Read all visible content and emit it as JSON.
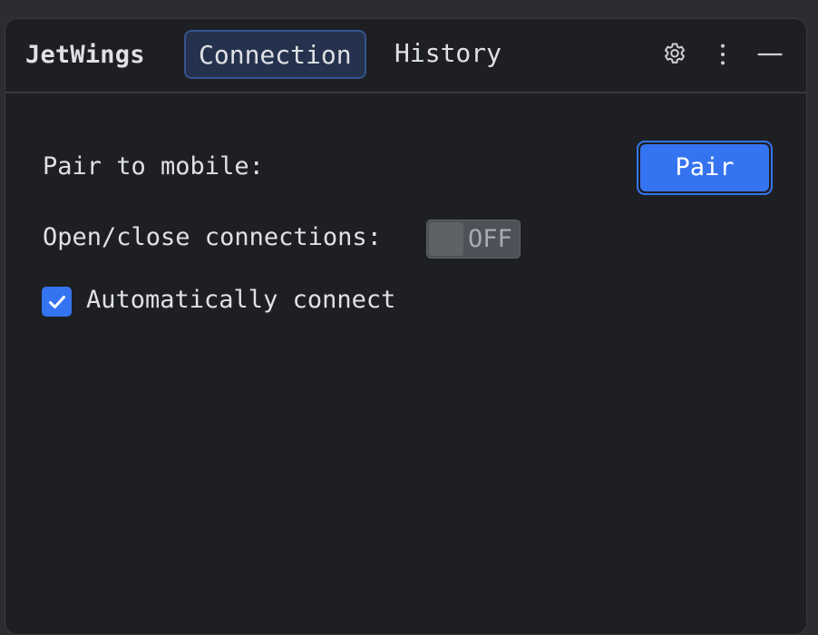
{
  "header": {
    "app_title": "JetWings",
    "tabs": [
      {
        "label": "Connection",
        "active": true
      },
      {
        "label": "History",
        "active": false
      }
    ],
    "icons": [
      "gear-icon",
      "more-vertical-icon",
      "minimize-icon"
    ]
  },
  "connection": {
    "pair_label": "Pair to mobile:",
    "pair_button_label": "Pair",
    "open_close_label": "Open/close connections:",
    "toggle_state": "OFF",
    "auto_connect_label": "Automatically connect",
    "auto_connect_checked": true
  },
  "colors": {
    "accent": "#3574f0",
    "background": "#1e1f22",
    "text": "#dfe1e5"
  }
}
